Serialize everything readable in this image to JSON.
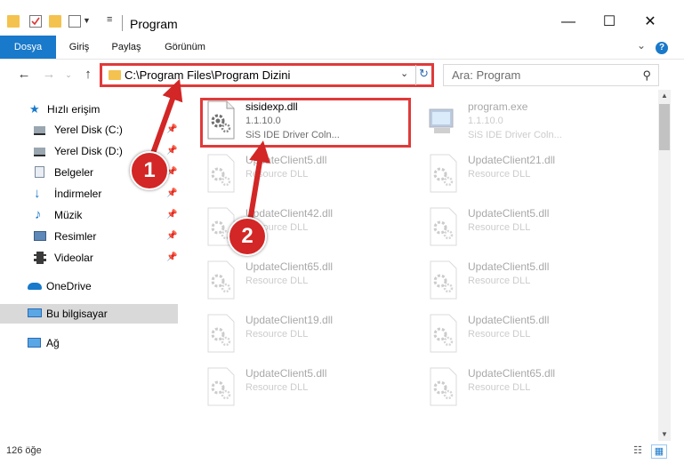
{
  "window": {
    "title": "Program",
    "controls": {
      "minimize": "—",
      "maximize": "☐",
      "close": "✕"
    }
  },
  "ribbon": {
    "tabs": [
      {
        "label": "Dosya",
        "active": true
      },
      {
        "label": "Giriş"
      },
      {
        "label": "Paylaş"
      },
      {
        "label": "Görünüm"
      }
    ],
    "help": "?"
  },
  "navigation": {
    "address": "C:\\Program Files\\Program Dizini",
    "search_placeholder": "Ara: Program"
  },
  "sidebar": {
    "items": [
      {
        "label": "Hızlı erişim",
        "icon": "star-icon",
        "pinned": false
      },
      {
        "label": "Yerel Disk (C:)",
        "icon": "drive-icon",
        "pinned": true
      },
      {
        "label": "Yerel Disk (D:)",
        "icon": "drive-icon",
        "pinned": true
      },
      {
        "label": "Belgeler",
        "icon": "documents-icon",
        "pinned": true
      },
      {
        "label": "İndirmeler",
        "icon": "download-icon",
        "pinned": true
      },
      {
        "label": "Müzik",
        "icon": "music-icon",
        "pinned": true
      },
      {
        "label": "Resimler",
        "icon": "pictures-icon",
        "pinned": true
      },
      {
        "label": "Videolar",
        "icon": "video-icon",
        "pinned": true
      },
      {
        "label": "OneDrive",
        "icon": "cloud-icon",
        "pinned": false
      },
      {
        "label": "Bu bilgisayar",
        "icon": "computer-icon",
        "pinned": false,
        "selected": true
      },
      {
        "label": "Ağ",
        "icon": "network-icon",
        "pinned": false
      }
    ]
  },
  "files": [
    {
      "name": "sisidexp.dll",
      "line2": "1.1.10.0",
      "line3": "SiS IDE Driver Coln...",
      "icon": "dll-gear-icon",
      "highlighted": true
    },
    {
      "name": "program.exe",
      "line2": "1.1.10.0",
      "line3": "SiS IDE Driver Coln...",
      "icon": "exe-icon"
    },
    {
      "name": "UpdateClient5.dll",
      "line2": "Resource DLL",
      "icon": "dll-gear-icon"
    },
    {
      "name": "UpdateClient21.dll",
      "line2": "Resource DLL",
      "icon": "dll-gear-icon"
    },
    {
      "name": "UpdateClient42.dll",
      "line2": "Resource DLL",
      "icon": "dll-gear-icon"
    },
    {
      "name": "UpdateClient5.dll",
      "line2": "Resource DLL",
      "icon": "dll-gear-icon"
    },
    {
      "name": "UpdateClient65.dll",
      "line2": "Resource DLL",
      "icon": "dll-gear-icon"
    },
    {
      "name": "UpdateClient5.dll",
      "line2": "Resource DLL",
      "icon": "dll-gear-icon"
    },
    {
      "name": "UpdateClient19.dll",
      "line2": "Resource DLL",
      "icon": "dll-gear-icon"
    },
    {
      "name": "UpdateClient5.dll",
      "line2": "Resource DLL",
      "icon": "dll-gear-icon"
    },
    {
      "name": "UpdateClient5.dll",
      "line2": "Resource DLL",
      "icon": "dll-gear-icon"
    },
    {
      "name": "UpdateClient65.dll",
      "line2": "Resource DLL",
      "icon": "dll-gear-icon"
    }
  ],
  "status": {
    "count": "126 öğe"
  },
  "annotations": [
    {
      "label": "1"
    },
    {
      "label": "2"
    }
  ],
  "colors": {
    "accent": "#1979ca",
    "annotation": "#e03a3a",
    "badge": "#d32626"
  }
}
